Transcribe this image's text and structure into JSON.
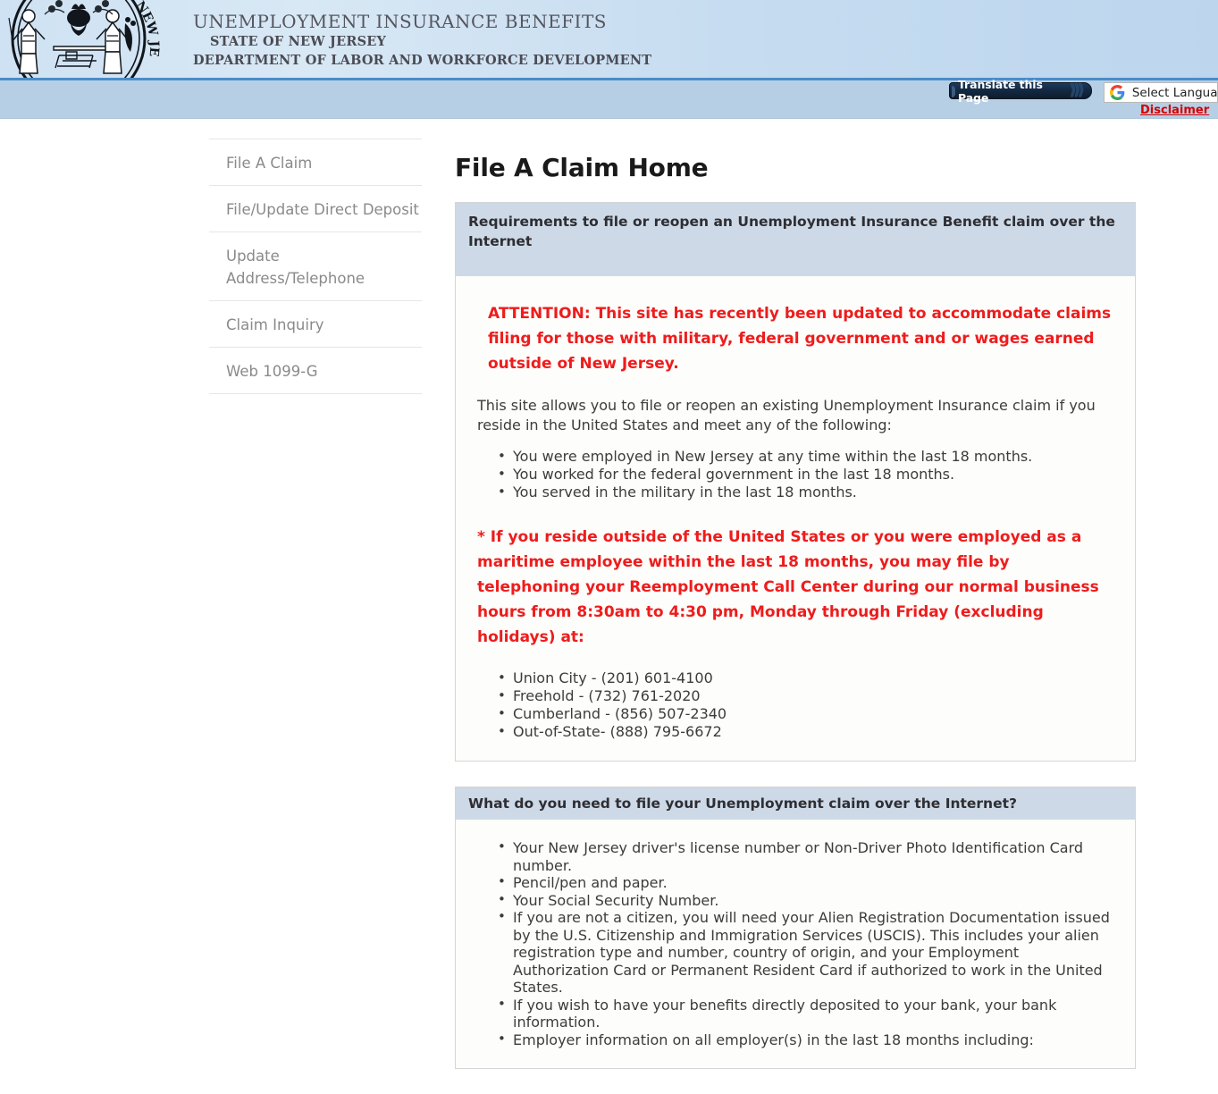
{
  "header": {
    "seal_icon": "nj-state-seal",
    "seal_arc_text": "NEW JERSEY",
    "title_main": "UNEMPLOYMENT INSURANCE BENEFITS",
    "title_sub1": "STATE OF NEW JERSEY",
    "title_sub2": "DEPARTMENT OF LABOR AND WORKFORCE DEVELOPMENT"
  },
  "translate": {
    "badge_label": "Translate this Page",
    "chevrons": "⟩⟩⟩",
    "google_icon": "google-g-logo",
    "select_label": "Select Language",
    "disclaimer_label": "Disclaimer"
  },
  "sidebar": {
    "items": [
      {
        "label": "File A Claim"
      },
      {
        "label": "File/Update Direct Deposit"
      },
      {
        "label": "Update Address/Telephone"
      },
      {
        "label": "Claim Inquiry"
      },
      {
        "label": "Web 1099-G"
      }
    ]
  },
  "main": {
    "page_title": "File A Claim Home",
    "panel1": {
      "heading": "Requirements to file or reopen an Unemployment Insurance Benefit claim over the Internet",
      "alert": "ATTENTION: This site has recently been updated to accommodate claims filing for those with military, federal government and or wages earned outside of New Jersey.",
      "intro": "This site allows you to file or reopen an existing Unemployment Insurance claim if you reside in the United States and meet any of the following:",
      "eligibility": [
        "You were employed in New Jersey at any time within the last 18 months.",
        "You worked for the federal government in the last 18 months.",
        "You served in the military in the last 18 months."
      ],
      "alert2": "* If you reside outside of the United States or you were employed as a maritime employee within the last 18 months, you may file by telephoning your Reemployment Call Center during our normal business hours from 8:30am to 4:30 pm, Monday through Friday (excluding holidays) at:",
      "phones": [
        "Union City - (201) 601-4100",
        "Freehold - (732) 761-2020",
        "Cumberland - (856) 507-2340",
        "Out-of-State- (888) 795-6672"
      ]
    },
    "panel2": {
      "heading": "What do you need to file your Unemployment claim over the Internet?",
      "items": [
        "Your New Jersey driver's license number or Non-Driver Photo Identification Card number.",
        "Pencil/pen and paper.",
        "Your Social Security Number.",
        "If you are not a citizen, you will need your Alien Registration Documentation issued by the U.S. Citizenship and Immigration Services (USCIS). This includes your alien registration type and number, country of origin, and your Employment Authorization Card or Permanent Resident Card if authorized to work in the United States.",
        "If you wish to have your benefits directly deposited to your bank, your bank information.",
        "Employer information on all employer(s) in the last 18 months including:"
      ]
    }
  },
  "colors": {
    "header_blue": "#cfe2f3",
    "subheader_blue": "#b6cfe5",
    "rule_blue": "#4a8cc8",
    "panel_head": "#cdd9e6",
    "alert_red": "#ee1c1c",
    "link_red": "#d40000"
  }
}
